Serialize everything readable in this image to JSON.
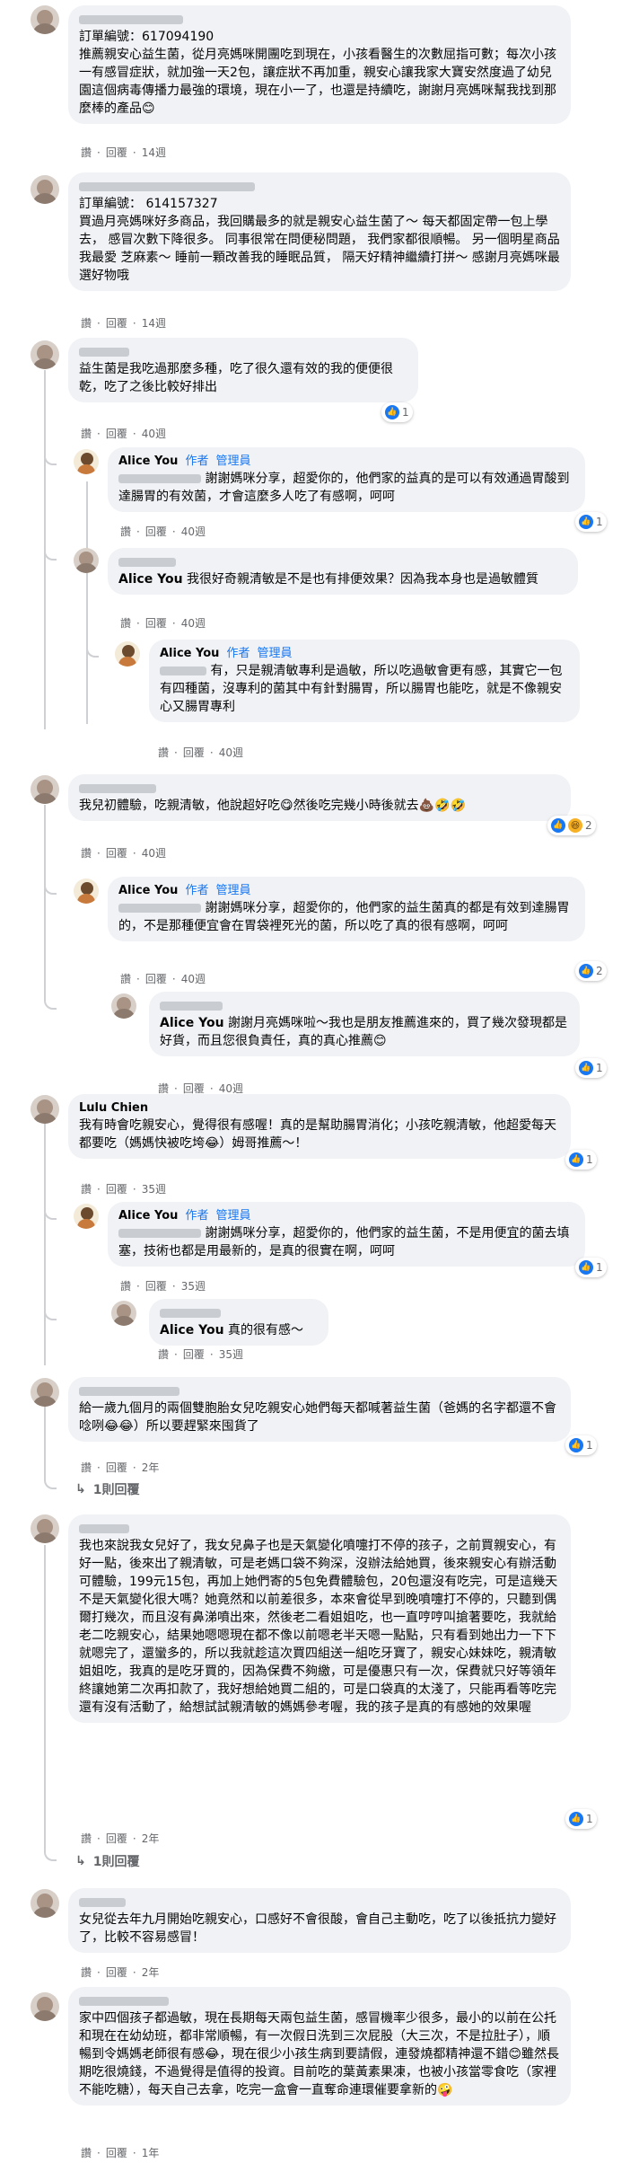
{
  "labels": {
    "like": "讚",
    "reply": "回覆",
    "dot": "·",
    "author": "作者",
    "admin": "管理員",
    "alice": "Alice You"
  },
  "c1": {
    "text": "訂單編號：617094190\n推薦親安心益生菌，從月亮媽咪開團吃到現在，小孩看醫生的次數屈指可數；每次小孩一有感冒症狀，就加強一天2包，讓症狀不再加重，親安心讓我家大寶安然度過了幼兒園這個病毒傳播力最強的環境，現在小一了，也還是持續吃，謝謝月亮媽咪幫我找到那麼棒的產品😊",
    "time": "14週"
  },
  "c2": {
    "text": "訂單編號： 614157327\n買過月亮媽咪好多商品，我回購最多的就是親安心益生菌了～ 每天都固定帶一包上學去， 感冒次數下降很多。 同事很常在問便秘問題， 我們家都很順暢。 另一個明星商品我最愛 芝麻素～ 睡前一顆改善我的睡眠品質， 隔天好精神繼續打拼～ 感謝月亮媽咪最選好物哦",
    "time": "14週"
  },
  "c3": {
    "text": "益生菌是我吃過那麼多種，吃了很久還有效的我的便便很乾，吃了之後比較好排出",
    "time": "40週",
    "rc": "1"
  },
  "c3r1": {
    "text": "謝謝媽咪分享，超愛你的，他們家的益真的是可以有效通過胃酸到達腸胃的有效菌，才會這麼多人吃了有感啊，呵呵",
    "time": "40週",
    "rc": "1"
  },
  "c3r2": {
    "mention": "Alice You",
    "text": " 我很好奇親清敏是不是也有排便效果？因為我本身也是過敏體質",
    "time": "40週"
  },
  "c3r3": {
    "text": "有，只是親清敏專利是過敏，所以吃過敏會更有感，其實它一包有四種菌，沒專利的菌其中有針對腸胃，所以腸胃也能吃，就是不像親安心又腸胃專利",
    "time": "40週"
  },
  "c4": {
    "text": "我兒初體驗，吃親清敏，他說超好吃😋然後吃完幾小時後就去💩🤣🤣",
    "time": "40週",
    "rc": "2"
  },
  "c4r1": {
    "text": "謝謝媽咪分享，超愛你的，他們家的益生菌真的都是有效到達腸胃的，不是那種便宜會在胃袋裡死光的菌，所以吃了真的很有感啊，呵呵",
    "time": "40週",
    "rc": "2"
  },
  "c4r2": {
    "mention": "Alice You",
    "text": " 謝謝月亮媽咪啦～我也是朋友推薦進來的，買了幾次發現都是好貨，而且您很負責任，真的真心推薦😊",
    "time": "40週",
    "rc": "1"
  },
  "c5": {
    "name": "Lulu Chien",
    "text": "我有時會吃親安心，覺得很有感喔！真的是幫助腸胃消化；小孩吃親清敏，他超愛每天都要吃（媽媽快被吃垮😂）姆哥推薦～！",
    "time": "35週",
    "rc": "1"
  },
  "c5r1": {
    "text": "謝謝媽咪分享，超愛你的，他們家的益生菌，不是用便宜的菌去填塞，技術也都是用最新的，是真的很實在啊，呵呵",
    "time": "35週",
    "rc": "1"
  },
  "c5r2": {
    "mention": "Alice You",
    "text": " 真的很有感～",
    "time": "35週"
  },
  "c6": {
    "text": "給一歲九個月的兩個雙胞胎女兒吃親安心她們每天都喊著益生菌（爸媽的名字都還不會唸咧😂😂）所以要趕緊來囤貨了",
    "time": "2年",
    "rc": "1",
    "more": "1則回覆"
  },
  "c7": {
    "text": "我也來說我女兒好了，我女兒鼻子也是天氣變化噴嚏打不停的孩子，之前買親安心，有好一點，後來出了親清敏，可是老媽口袋不夠深，沒辦法給她買，後來親安心有辦活動可體驗，199元15包，再加上她們寄的5包免費體驗包，20包還沒有吃完，可是這幾天不是天氣變化很大嗎？她竟然和以前差很多，本來會從早到晚噴嚏打不停的，只聽到偶爾打幾次，而且沒有鼻涕噴出來，然後老二看姐姐吃，也一直哼哼叫搶著要吃，我就給老二吃親安心，結果她嗯嗯現在都不像以前嗯老半天嗯一點點，只有看到她出力一下下就嗯完了，還蠻多的，所以我就趁這次買四組送一組吃牙寶了，親安心妹妹吃，親清敏姐姐吃，我真的是吃牙買的，因為保費不夠繳，可是優惠只有一次，保費就只好等領年終讓她第二次再扣款了，我好想給她買二組的，可是口袋真的太淺了，只能再看等吃完還有沒有活動了，給想試試親清敏的媽媽參考喔，我的孩子是真的有感她的效果喔",
    "time": "2年",
    "rc": "1",
    "more": "1則回覆"
  },
  "c8": {
    "text": "女兒從去年九月開始吃親安心，口感好不會很酸，會自己主動吃，吃了以後抵抗力變好了，比較不容易感冒！",
    "time": "2年"
  },
  "c9": {
    "text": "家中四個孩子都過敏，現在長期每天兩包益生菌，感冒機率少很多，最小的以前在公托和現在在幼幼班，都非常順暢，有一次假日洗到三次屁股（大三次，不是拉肚子），順暢到令媽媽老師很有感😂，現在很少小孩生病到要請假，連發燒都精神還不錯😊雖然長期吃很燒錢，不過覺得是值得的投資。目前吃的葉黃素果凍，也被小孩當零食吃（家裡不能吃糖），每天自己去拿，吃完一盒會一直奪命連環催要拿新的🤪",
    "time": "1年"
  }
}
